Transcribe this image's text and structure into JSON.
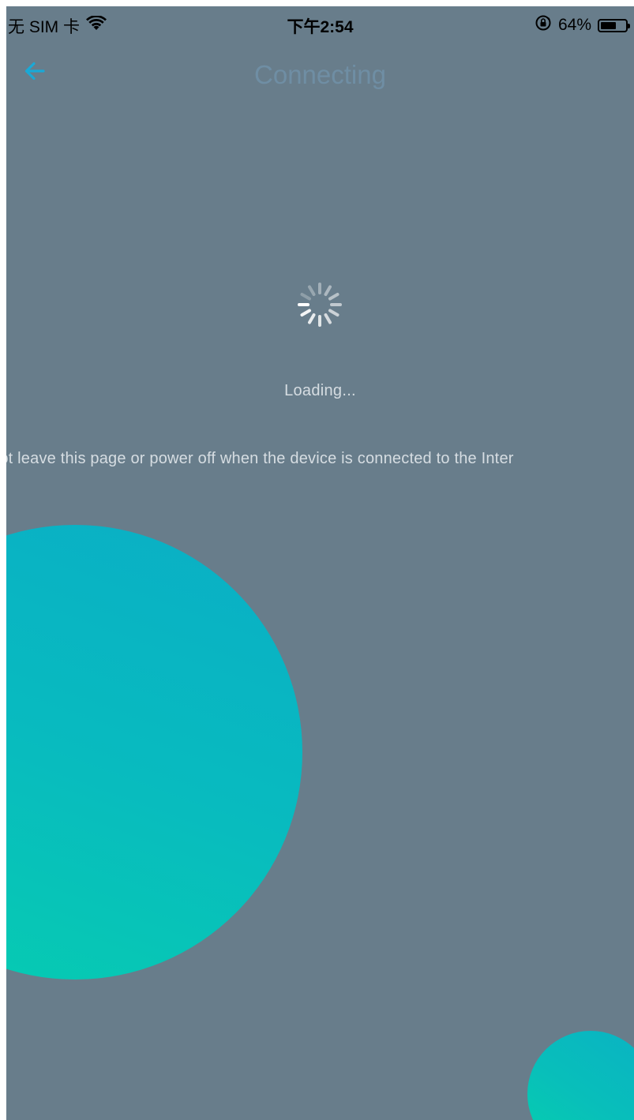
{
  "status_bar": {
    "carrier": "无 SIM 卡",
    "time": "下午2:54",
    "battery_percent": "64%",
    "battery_level": 0.64,
    "icons": [
      "wifi-icon",
      "rotation-lock-icon",
      "battery-icon"
    ]
  },
  "nav": {
    "back_icon": "back-arrow-icon",
    "title": "Connecting"
  },
  "content": {
    "spinner_icon": "loading-spinner-icon",
    "loading_text": "Loading...",
    "warning_text": "not leave this page or power off when the device is connected to the Inter"
  },
  "colors": {
    "background": "#687d8b",
    "accent": "#1aa9d6",
    "title": "#6f8ea4",
    "bubble_top": "#0aaec6",
    "bubble_bottom": "#06cdb0"
  }
}
